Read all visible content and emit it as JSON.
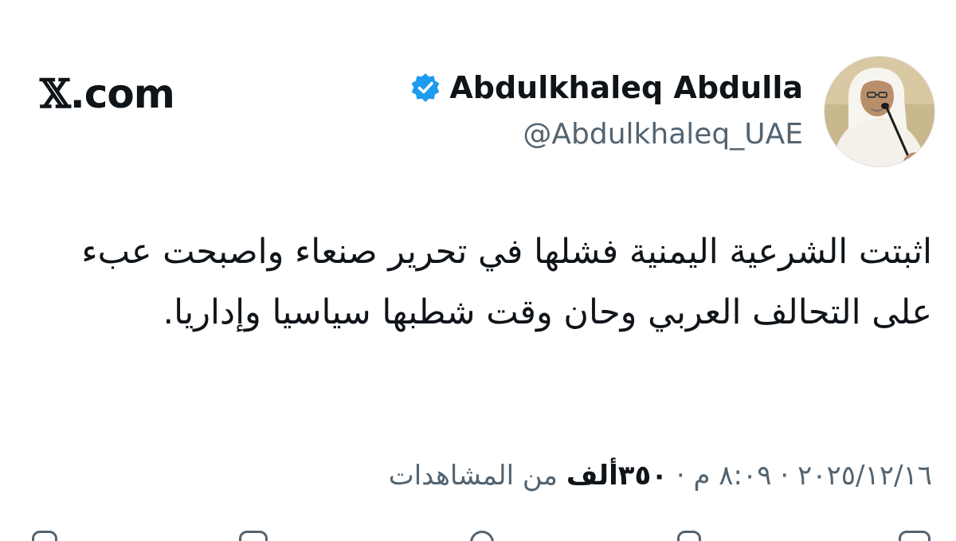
{
  "brand": {
    "text": ".com"
  },
  "author": {
    "display_name": "Abdulkhaleq Abdulla",
    "handle": "@Abdulkhaleq_UAE",
    "verified": true
  },
  "tweet": {
    "text": "اثبتت الشرعية اليمنية فشلها في تحرير صنعاء واصبحت عبء على التحالف العربي وحان وقت شطبها سياسيا وإداريا."
  },
  "meta": {
    "date": "٢٠٢٥/١٢/١٦",
    "time": "٨:٠٩ م",
    "separator": "·",
    "views_count": "٣٥٠ألف",
    "views_label": "من المشاهدات"
  },
  "icons": {
    "brand": "x-logo-icon",
    "verified": "verified-badge-icon",
    "avatar": "profile-photo"
  },
  "colors": {
    "text": "#0f1419",
    "secondary": "#536471",
    "verified": "#1d9bf0"
  }
}
